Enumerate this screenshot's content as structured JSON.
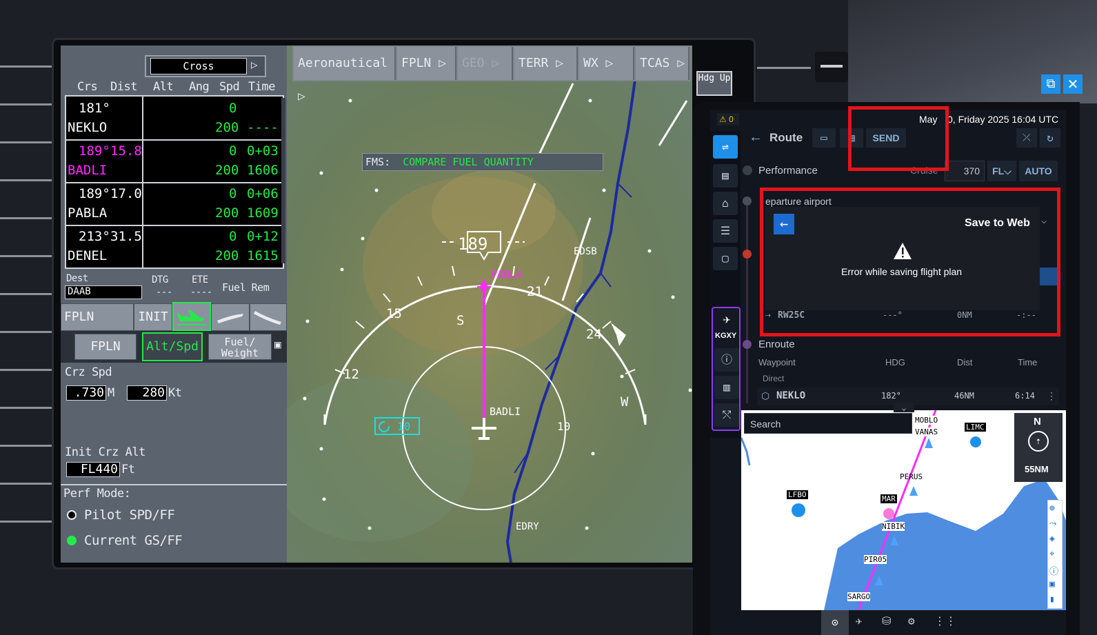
{
  "fms": {
    "cross_label": "Cross",
    "headers": [
      "Crs",
      "Dist",
      "Alt",
      "Ang",
      "Spd",
      "Time"
    ],
    "legs": [
      {
        "crs": "181°",
        "dist": "",
        "ang": "0",
        "wpt": "NEKLO",
        "spd": "200",
        "time": "----",
        "active": false
      },
      {
        "crs": "189°",
        "dist": "15.8",
        "ang": "0",
        "ete": "0+03",
        "wpt": "BADLI",
        "spd": "200",
        "time": "1606",
        "active": true
      },
      {
        "crs": "189°",
        "dist": "17.0",
        "ang": "0",
        "ete": "0+06",
        "wpt": "PABLA",
        "spd": "200",
        "time": "1609",
        "active": false
      },
      {
        "crs": "213°",
        "dist": "31.5",
        "ang": "0",
        "ete": "0+12",
        "wpt": "DENEL",
        "spd": "200",
        "time": "1615",
        "active": false
      }
    ],
    "dest_label": "Dest",
    "dest_value": "DAAB",
    "dtg_label": "DTG",
    "dtg_value": "---",
    "ete_label": "ETE",
    "ete_value": "----",
    "fuel_rem_label": "Fuel Rem",
    "tab_fpln": "FPLN",
    "tab_init": "INIT",
    "sub_fpln": "FPLN",
    "sub_altspd": "Alt/Spd",
    "sub_fuel": "Fuel/ Weight",
    "crz_spd_label": "Crz Spd",
    "crz_mach": ".730",
    "mach_unit": "M",
    "crz_kt": "280",
    "kt_unit": "Kt",
    "init_crz_alt_label": "Init Crz Alt",
    "init_crz_alt": "FL440",
    "ft_unit": "Ft",
    "perf_mode_label": "Perf Mode:",
    "perf_opt1": "Pilot SPD/FF",
    "perf_opt2": "Current GS/FF",
    "perf_selected": 2
  },
  "nd": {
    "tabs": [
      "Aeronautical",
      "FPLN",
      "GEO",
      "TERR",
      "WX",
      "TCAS"
    ],
    "hdg_up": "Hdg Up",
    "fms_msg_label": "FMS:",
    "fms_msg": "COMPARE FUEL QUANTITY",
    "heading": "189",
    "compass_labels": [
      "S",
      "21",
      "24",
      "W",
      "15",
      "12"
    ],
    "range_labels": [
      "10",
      "10"
    ],
    "waypoints": [
      "PABLA",
      "BADLI",
      "EDSB",
      "EDRY"
    ]
  },
  "efb": {
    "alert_count": "0",
    "date": "May 30, Friday 2025 16:04 UTC",
    "date_left": "May",
    "date_right": "0, Friday 2025 16:04 UTC",
    "route_title": "Route",
    "send_label": "SEND",
    "performance_label": "Performance",
    "cruise_label": "Cruise",
    "cruise_value": "370",
    "fl_label": "FL",
    "auto_label": "AUTO",
    "departure_label": "eparture airport",
    "dialog_title": "Save to Web",
    "dialog_error": "Error while saving flight plan",
    "rwy": {
      "name": "RW25C",
      "hdg": "---°",
      "dist": "0NM",
      "time": "-:--"
    },
    "origin_code": "KGXY",
    "enroute_label": "Enroute",
    "columns": [
      "Waypoint",
      "HDG",
      "Dist",
      "Time"
    ],
    "direct_label": "Direct",
    "next_wpt": {
      "name": "NEKLO",
      "hdg": "182°",
      "dist": "46NM",
      "time": "6:14"
    },
    "search_placeholder": "Search",
    "map_labels": [
      "MOBLO",
      "VANAS",
      "LIMC",
      "PERUS",
      "LFBO",
      "MAR",
      "NIBIK",
      "PIR05",
      "SARGO"
    ],
    "compass_n": "N",
    "map_range": "55NM",
    "colors": {
      "accent": "#1e90e8",
      "alert_red": "#e3141b",
      "magenta": "#ff2cff",
      "fms_green": "#27e84b"
    }
  }
}
